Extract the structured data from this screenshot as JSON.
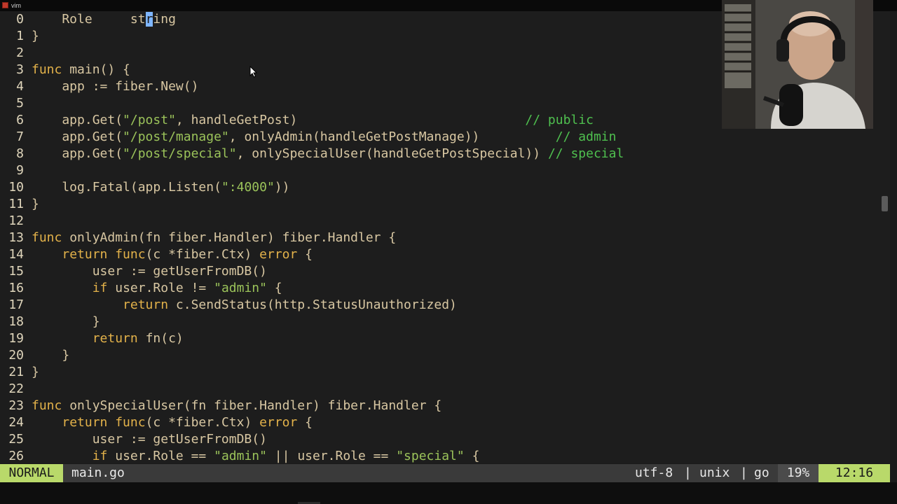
{
  "window": {
    "title": "vim"
  },
  "editor": {
    "lines": [
      {
        "num": "0",
        "tokens": [
          {
            "t": "    Role     st"
          },
          {
            "t": "r",
            "c": "cursor"
          },
          {
            "t": "ing"
          }
        ]
      },
      {
        "num": "1",
        "tokens": [
          {
            "t": "}"
          }
        ]
      },
      {
        "num": "2",
        "tokens": []
      },
      {
        "num": "3",
        "tokens": [
          {
            "t": "func",
            "c": "kw"
          },
          {
            "t": " main() {"
          }
        ]
      },
      {
        "num": "4",
        "tokens": [
          {
            "t": "    app := fiber.New()"
          }
        ]
      },
      {
        "num": "5",
        "tokens": []
      },
      {
        "num": "6",
        "tokens": [
          {
            "t": "    app.Get("
          },
          {
            "t": "\"/post\"",
            "c": "str"
          },
          {
            "t": ", handleGetPost)                              "
          },
          {
            "t": "// public",
            "c": "cmt"
          }
        ]
      },
      {
        "num": "7",
        "tokens": [
          {
            "t": "    app.Get("
          },
          {
            "t": "\"/post/manage\"",
            "c": "str"
          },
          {
            "t": ", onlyAdmin(handleGetPostManage))          "
          },
          {
            "t": "// admin",
            "c": "cmt"
          }
        ]
      },
      {
        "num": "8",
        "tokens": [
          {
            "t": "    app.Get("
          },
          {
            "t": "\"/post/special\"",
            "c": "str"
          },
          {
            "t": ", onlySpecialUser(handleGetPostSpecial)) "
          },
          {
            "t": "// special",
            "c": "cmt"
          }
        ]
      },
      {
        "num": "9",
        "tokens": []
      },
      {
        "num": "10",
        "tokens": [
          {
            "t": "    log.Fatal(app.Listen("
          },
          {
            "t": "\":4000\"",
            "c": "str"
          },
          {
            "t": "))"
          }
        ]
      },
      {
        "num": "11",
        "tokens": [
          {
            "t": "}"
          }
        ]
      },
      {
        "num": "12",
        "tokens": []
      },
      {
        "num": "13",
        "tokens": [
          {
            "t": "func",
            "c": "kw"
          },
          {
            "t": " onlyAdmin(fn fiber.Handler) fiber.Handler {"
          }
        ]
      },
      {
        "num": "14",
        "tokens": [
          {
            "t": "    "
          },
          {
            "t": "return func",
            "c": "kw"
          },
          {
            "t": "(c *fiber.Ctx) "
          },
          {
            "t": "error",
            "c": "kw"
          },
          {
            "t": " {"
          }
        ]
      },
      {
        "num": "15",
        "tokens": [
          {
            "t": "        user := getUserFromDB()"
          }
        ]
      },
      {
        "num": "16",
        "tokens": [
          {
            "t": "        "
          },
          {
            "t": "if",
            "c": "kw"
          },
          {
            "t": " user.Role != "
          },
          {
            "t": "\"admin\"",
            "c": "str"
          },
          {
            "t": " {"
          }
        ]
      },
      {
        "num": "17",
        "tokens": [
          {
            "t": "            "
          },
          {
            "t": "return",
            "c": "kw"
          },
          {
            "t": " c.SendStatus(http.StatusUnauthorized)"
          }
        ]
      },
      {
        "num": "18",
        "tokens": [
          {
            "t": "        }"
          }
        ]
      },
      {
        "num": "19",
        "tokens": [
          {
            "t": "        "
          },
          {
            "t": "return",
            "c": "kw"
          },
          {
            "t": " fn(c)"
          }
        ]
      },
      {
        "num": "20",
        "tokens": [
          {
            "t": "    }"
          }
        ]
      },
      {
        "num": "21",
        "tokens": [
          {
            "t": "}"
          }
        ]
      },
      {
        "num": "22",
        "tokens": []
      },
      {
        "num": "23",
        "tokens": [
          {
            "t": "func",
            "c": "kw"
          },
          {
            "t": " onlySpecialUser(fn fiber.Handler) fiber.Handler {"
          }
        ]
      },
      {
        "num": "24",
        "tokens": [
          {
            "t": "    "
          },
          {
            "t": "return func",
            "c": "kw"
          },
          {
            "t": "(c *fiber.Ctx) "
          },
          {
            "t": "error",
            "c": "kw"
          },
          {
            "t": " {"
          }
        ]
      },
      {
        "num": "25",
        "tokens": [
          {
            "t": "        user := getUserFromDB()"
          }
        ]
      },
      {
        "num": "26",
        "tokens": [
          {
            "t": "        "
          },
          {
            "t": "if",
            "c": "kw"
          },
          {
            "t": " user.Role == "
          },
          {
            "t": "\"admin\"",
            "c": "str"
          },
          {
            "t": " || user.Role == "
          },
          {
            "t": "\"special\"",
            "c": "str"
          },
          {
            "t": " {"
          }
        ]
      }
    ]
  },
  "statusline": {
    "mode": "NORMAL",
    "filename": "main.go",
    "encoding": "utf-8",
    "separator": "|",
    "fileformat": "unix",
    "filetype": "go",
    "percent": "19%",
    "position": "12:16"
  },
  "colors": {
    "background": "#1d1d1d",
    "keyword": "#e3b24a",
    "string": "#9bc35a",
    "comment": "#4fc04f",
    "mode_bg": "#b9d96a"
  },
  "icons": {
    "app": "vim-icon",
    "pointer": "mouse-pointer-icon"
  }
}
